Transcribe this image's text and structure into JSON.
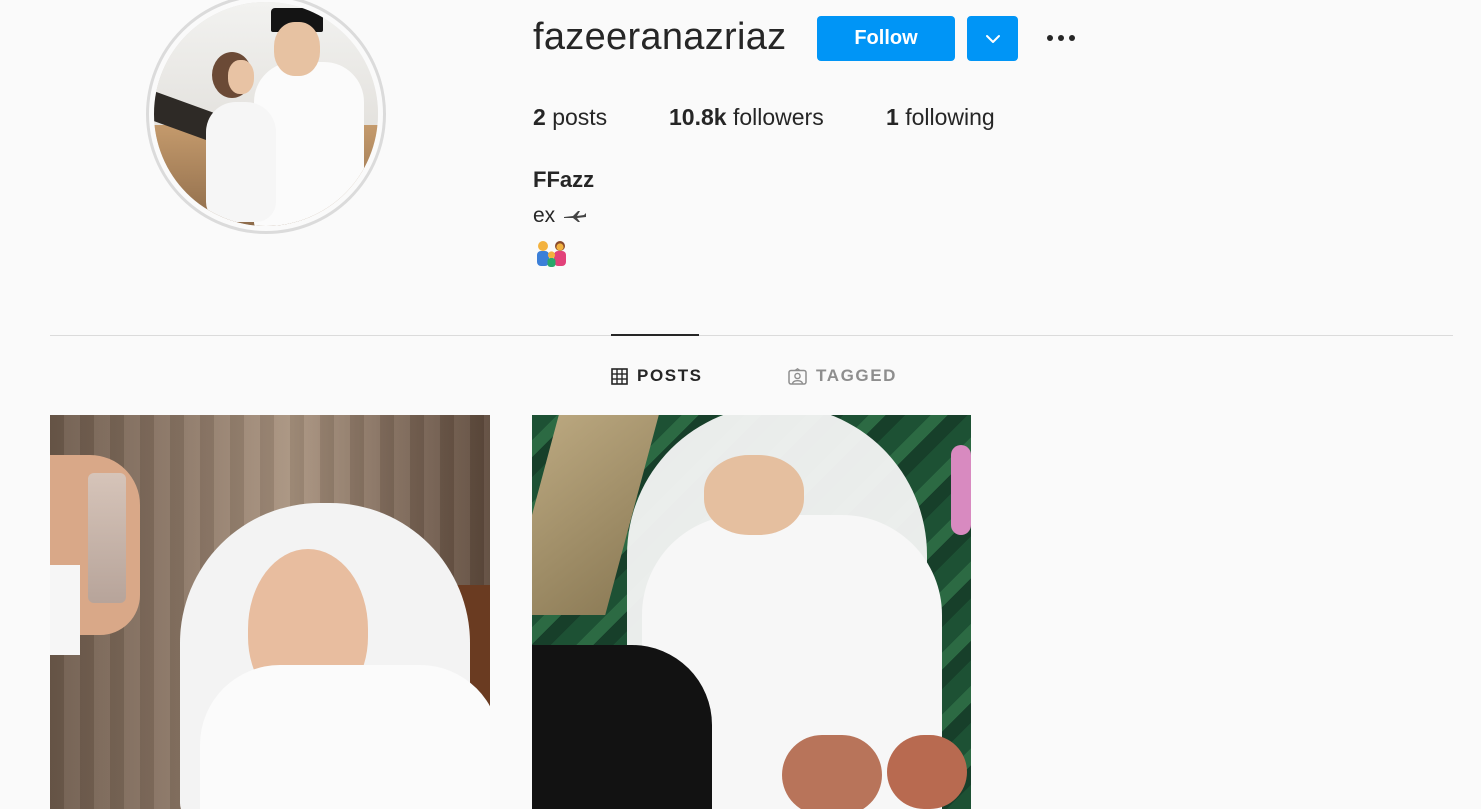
{
  "profile": {
    "username": "fazeeranazriaz",
    "follow_label": "Follow",
    "stats": {
      "posts_count": "2",
      "posts_label": "posts",
      "followers_count": "10.8k",
      "followers_label": "followers",
      "following_count": "1",
      "following_label": "following"
    },
    "full_name": "FFazz",
    "bio_text": "ex",
    "bio_icon": "airplane-icon",
    "bio_emoji": "family-icon"
  },
  "tabs": [
    {
      "label": "POSTS",
      "icon": "grid-icon",
      "active": true
    },
    {
      "label": "TAGGED",
      "icon": "tagged-icon",
      "active": false
    }
  ],
  "colors": {
    "accent": "#0095f6",
    "text": "#262626",
    "muted": "#8e8e8e",
    "divider": "#dbdbdb",
    "background": "#fafafa"
  }
}
